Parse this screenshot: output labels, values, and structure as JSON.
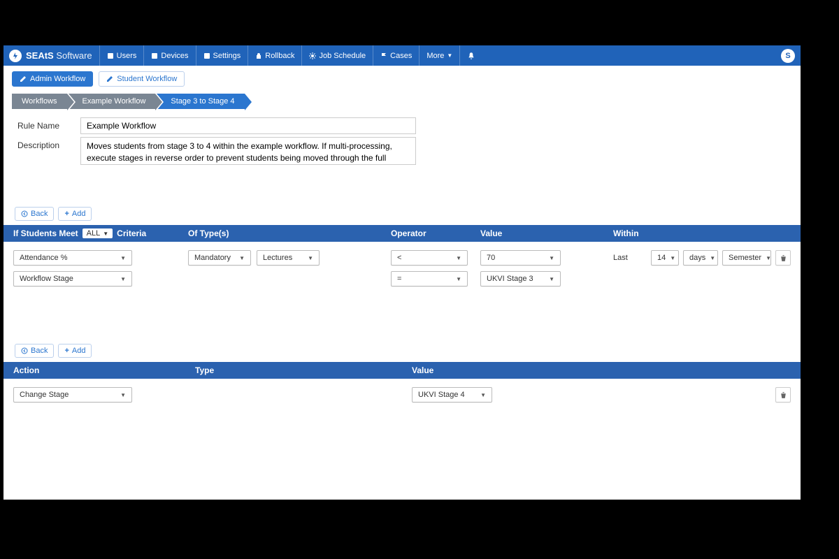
{
  "brand": {
    "bold": "SEAtS",
    "light": "Software",
    "logo_initial": "S"
  },
  "nav": {
    "users": "Users",
    "devices": "Devices",
    "settings": "Settings",
    "rollback": "Rollback",
    "job_schedule": "Job Schedule",
    "cases": "Cases",
    "more": "More"
  },
  "subtabs": {
    "admin": "Admin Workflow",
    "student": "Student Workflow"
  },
  "breadcrumb": {
    "workflows": "Workflows",
    "example": "Example Workflow",
    "stage": "Stage 3 to Stage 4"
  },
  "form": {
    "rule_name_label": "Rule Name",
    "rule_name": "Example Workflow",
    "description_label": "Description",
    "description": "Moves students from stage 3 to 4 within the example workflow. If multi-processing, execute stages in reverse order to prevent students being moved through the full workflow at once"
  },
  "buttons": {
    "back": "Back",
    "add": "Add"
  },
  "criteria_table": {
    "header_prefix": "If Students Meet",
    "header_pill": "ALL",
    "header_suffix": "Criteria",
    "types_header": "Of Type(s)",
    "operator_header": "Operator",
    "value_header": "Value",
    "within_header": "Within",
    "rows": {
      "r1": {
        "field": "Attendance %",
        "type1": "Mandatory",
        "type2": "Lectures",
        "operator": "<",
        "value": "70",
        "within_prefix": "Last",
        "within_count": "14",
        "within_unit": "days",
        "within_scope": "Semester"
      },
      "r2": {
        "field": "Workflow Stage",
        "operator": "=",
        "value": "UKVI Stage 3"
      }
    }
  },
  "action_table": {
    "action_header": "Action",
    "type_header": "Type",
    "value_header": "Value",
    "rows": {
      "a1": {
        "action": "Change Stage",
        "value": "UKVI Stage 4"
      }
    }
  },
  "user_initial": "S"
}
